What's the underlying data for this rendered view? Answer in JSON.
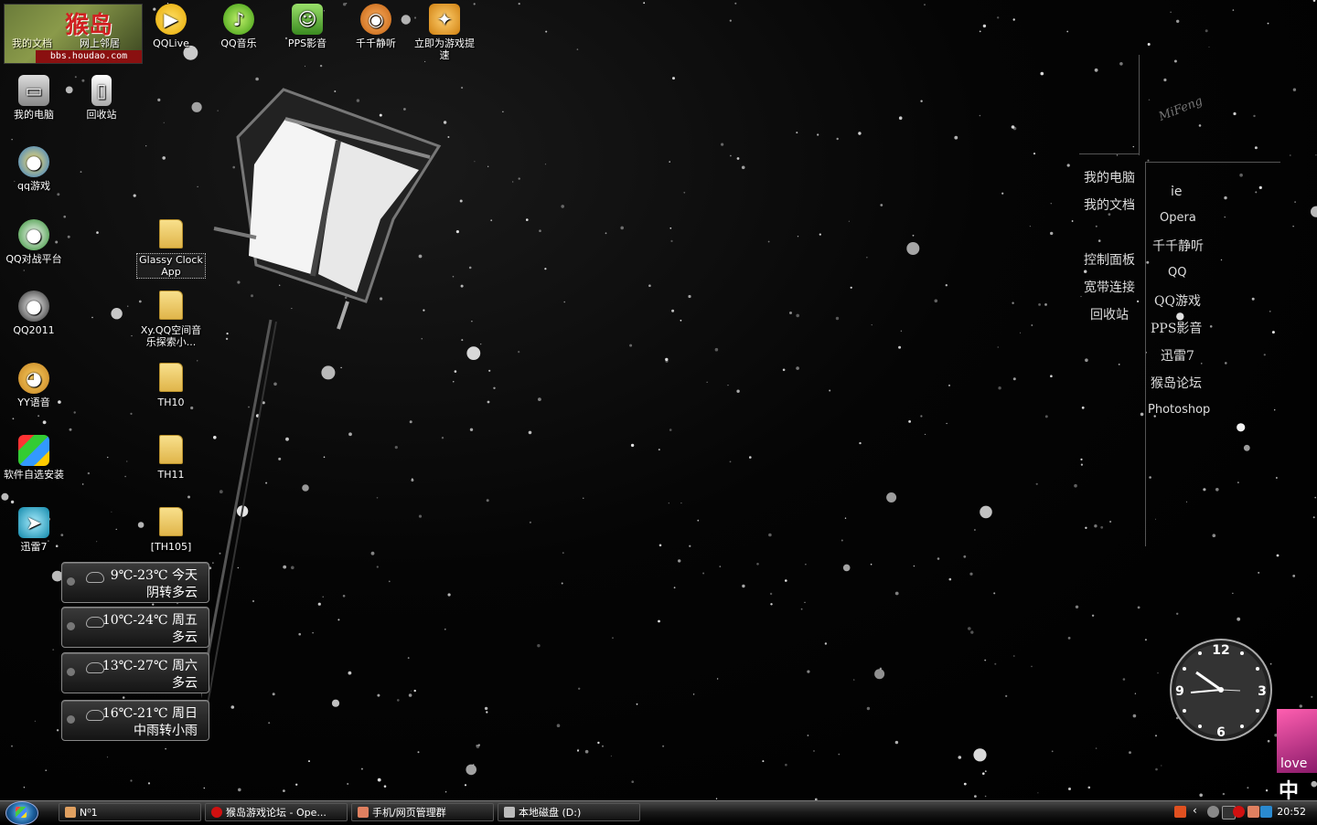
{
  "banner": {
    "logo": "猴岛",
    "label_docs": "我的文档",
    "label_network": "网上邻居",
    "site": "bbs.houdao.com"
  },
  "desktop_icons": {
    "qqlive": "QQLive",
    "qqmusic": "QQ音乐",
    "pps": "PPS影音",
    "ttplayer": "千千静听",
    "game_speedup": "立即为游戏提速",
    "my_computer": "我的电脑",
    "recycle_bin": "回收站",
    "qqgame": "qq游戏",
    "qq_battle": "QQ对战平台",
    "qq2011": "QQ2011",
    "yy": "YY语音",
    "software_install": "软件自选安装",
    "xunlei": "迅雷7",
    "glassy_clock": "Glassy Clock App",
    "xy_qq": "Xy.QQ空间音乐探索小...",
    "th10": "TH10",
    "th11": "TH11",
    "th105": "[TH105]"
  },
  "weather": [
    {
      "temp": "9℃-23℃",
      "day": "今天",
      "cond": "阴转多云"
    },
    {
      "temp": "10℃-24℃",
      "day": "周五",
      "cond": "多云"
    },
    {
      "temp": "13℃-27℃",
      "day": "周六",
      "cond": "多云"
    },
    {
      "temp": "16℃-21℃",
      "day": "周日",
      "cond": "中雨转小雨"
    }
  ],
  "right_menu_left": [
    "我的电脑",
    "我的文档",
    "控制面板",
    "宽带连接",
    "回收站"
  ],
  "right_menu_right": [
    "ie",
    "Opera",
    "千千静听",
    "QQ",
    "QQ游戏",
    "PPS影音",
    "迅雷7",
    "猴岛论坛",
    "Photoshop"
  ],
  "mifeng": "MiFeng",
  "clock_face": {
    "n12": "12",
    "n3": "3",
    "n6": "6",
    "n9": "9"
  },
  "love_text": "love",
  "ime_text": "中",
  "taskbar": {
    "tasks": [
      "N⁰1",
      "猴岛游戏论坛 - Ope...",
      "手机/网页管理群",
      "本地磁盘 (D:)"
    ],
    "time": "20:52"
  },
  "colors": {
    "taskbar_bg": "#1a1a1a",
    "accent": "#1a5c9a"
  }
}
